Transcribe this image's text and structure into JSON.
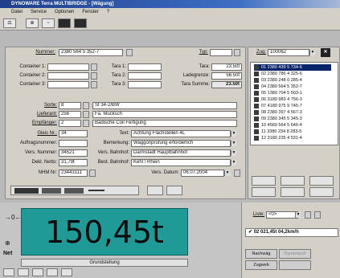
{
  "app": {
    "title": "DYNOWARE Terra MULTIBRIDGE - [Wägung]"
  },
  "menu": [
    "Datei",
    "Service",
    "Optionen",
    "Fenster",
    "?"
  ],
  "form": {
    "nummer_label": "Nummer:",
    "nummer_value": "2380 564 5 352-7",
    "typ_label": "Typ:",
    "container1_label": "Container 1:",
    "container2_label": "Container 2:",
    "container3_label": "Container 3:",
    "tara1_label": "Tara 1:",
    "tara2_label": "Tara 2:",
    "tara3_label": "Tara 3:",
    "tara_label": "Tara:",
    "tara_value": "23.50t",
    "ladegrenze_label": "Ladegrenze:",
    "ladegrenze_value": "56.50t",
    "tara_summe_label": "Tara Summe:",
    "tara_summe_value": "23.50t",
    "sorte_label": "Sorte:",
    "sorte_code": "8",
    "sorte_value": "St 34-2/BW",
    "lieferant_label": "Lieferant:",
    "lieferant_code": "256",
    "lieferant_value": "Fa. Mucksch",
    "empfaenger_label": "Empfänger:",
    "empfaenger_code": "2",
    "empfaenger_value": "Badische Coil Fertigung",
    "gleis_label": "Gleis Nr.:",
    "gleis_value": "34",
    "text_label": "Text:",
    "text_value": "Achtung Flachstellen 4L",
    "auftrag_label": "Auftragsnummer:",
    "bemerkung_label": "Bemerkung:",
    "bemerkung_value": "Waggonprüfung erforderlich",
    "versnummer_label": "Vers. Nummer:",
    "versnummer_value": "34521",
    "versbahnhof_label": "Vers. Bahnhof:",
    "versbahnhof_value": "Darmstadt Hauptbahnhof",
    "deklnetto_label": "Dekl. Netto:",
    "deklnetto_value": "31,79t",
    "bestbahnhof_label": "Best. Bahnhof:",
    "bestbahnhof_value": "Kehl / Rhein",
    "nhm_label": "NHM Nr:",
    "nhm_value": "23443111",
    "versdatum_label": "Vers. Datum:",
    "versdatum_value": "06.07.2004"
  },
  "right_panel": {
    "zug_label": "Zug:",
    "zug_value": "100062",
    "items": [
      "01 2380 439 5 734-6",
      "02 2380 786 4 325-6",
      "03 2380 248 0 285-4",
      "04 2380 564 5 352-7",
      "05 1380 704 5 503-1",
      "06 3180 983 4 756-3",
      "07 4180 975 9 745-7",
      "08 2380 397 4 567-3",
      "09 2380 345 5 345-3",
      "10 4560 564 5 646-4",
      "11 3380 234 8 283-5",
      "12 3180 235 4 531-4"
    ]
  },
  "scale": {
    "display_value": "150,45t",
    "net_label": "Net",
    "grundstellung": "Grundstellung"
  },
  "bottom_right": {
    "liste_label": "Liste:",
    "liste_value": "<0>",
    "result_value": "02 021,45t 04,2km/h",
    "nachwaeg_label": "Nachwäg",
    "dynamisch_label": "Dynamisch",
    "zugweb_label": "Zugweb"
  }
}
